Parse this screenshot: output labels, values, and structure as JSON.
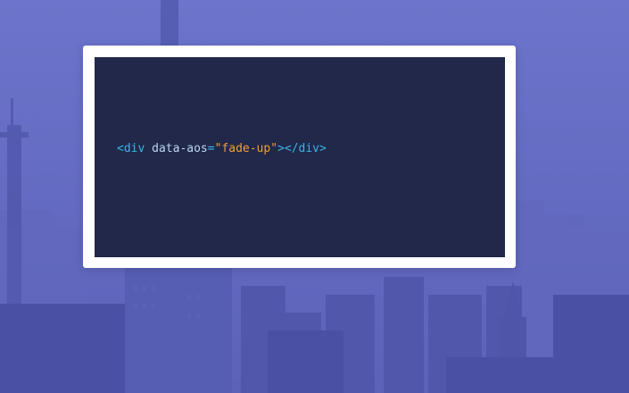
{
  "background": {
    "tint_color": "#6b73c9",
    "scene_icon": "city-skyline-icon"
  },
  "code_card": {
    "frame_color": "#ffffff",
    "panel_color": "#21284a",
    "tokens": {
      "open_tag": "<div",
      "space": " ",
      "attr_name": "data-aos",
      "equals": "=",
      "attr_value": "\"fade-up\"",
      "close_open": ">",
      "close_tag": "</div>"
    },
    "colors": {
      "tag": "#3cb4e4",
      "attr": "#bcd6ee",
      "string": "#f0a030"
    }
  }
}
